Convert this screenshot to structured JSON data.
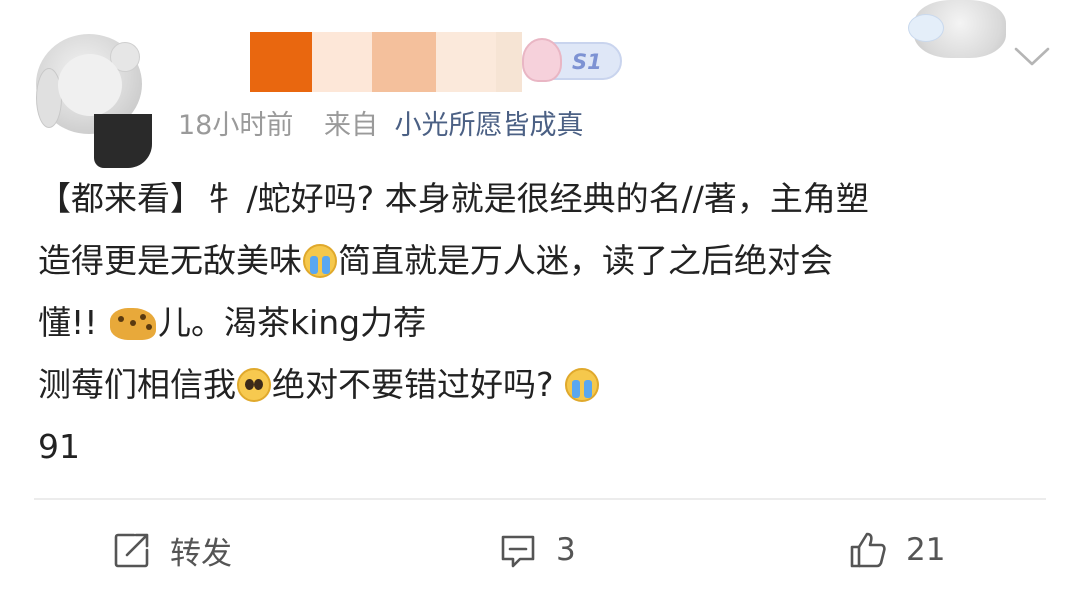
{
  "header": {
    "timestamp": "18小时前",
    "source_label": "来自",
    "source_name": "小光所愿皆成真",
    "badge_text": "S1"
  },
  "content": {
    "lines": [
      "【都来看】牜 /蛇好吗? 本身就是很经典的名//著，主角塑",
      "造得更是无敌美味",
      "简直就是万人迷，读了之后绝对会",
      "懂!!",
      "儿。渴茶king力荐",
      "测莓们相信我",
      "绝对不要错过好吗?",
      "91"
    ]
  },
  "actions": {
    "repost_label": "转发",
    "comment_count": "3",
    "like_count": "21"
  },
  "icons": {
    "more": "chevron-down-icon",
    "repost": "share-icon",
    "comment": "comment-icon",
    "like": "thumbs-up-icon"
  },
  "colors": {
    "source_link": "#4b6084",
    "meta_gray": "#9a9a9a",
    "text": "#222222"
  }
}
